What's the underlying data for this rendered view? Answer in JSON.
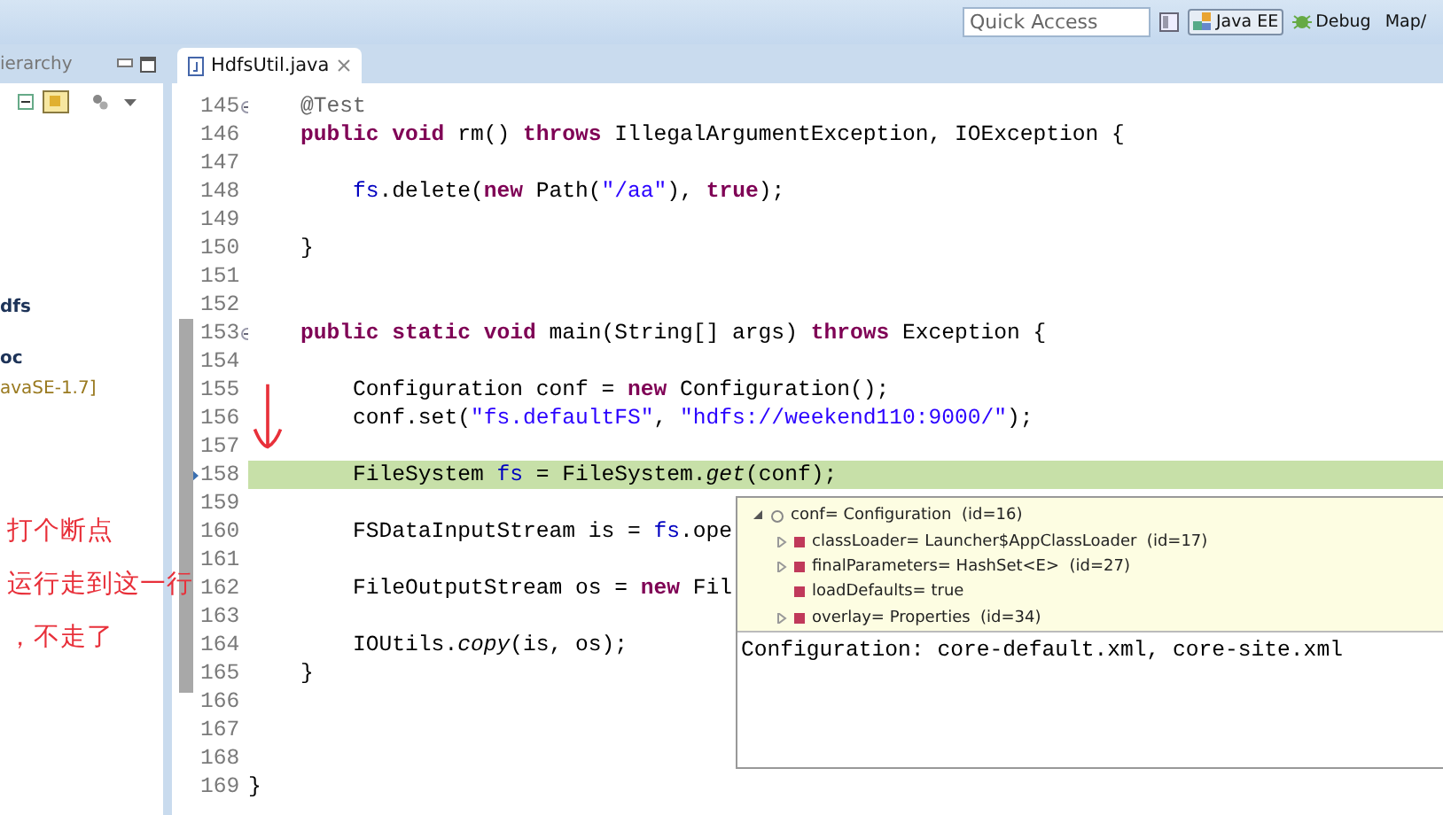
{
  "toolbar": {
    "quick_access": {
      "placeholder": "Quick Access"
    },
    "perspectives": [
      {
        "label": "Java EE",
        "selected": true
      },
      {
        "label": "Debug",
        "selected": false
      },
      {
        "label": "Map/",
        "selected": false
      }
    ]
  },
  "left_panel": {
    "tab_label": "ierarchy",
    "items": [
      {
        "label": "dfs",
        "kind": "project"
      },
      {
        "label": "oc",
        "kind": "project"
      },
      {
        "label": "avaSE-1.7]",
        "kind": "library"
      }
    ]
  },
  "editor": {
    "tab": {
      "label": "HdfsUtil.java",
      "selected": true
    },
    "lines": [
      {
        "number": "145",
        "foldable": true,
        "current": false,
        "tokens": [
          {
            "text": "    @Test",
            "kind": "annotation"
          }
        ]
      },
      {
        "number": "146",
        "foldable": false,
        "current": false,
        "tokens": [
          {
            "text": "    public void",
            "kind": "keyword"
          },
          {
            "text": " rm() ",
            "kind": "plain"
          },
          {
            "text": "throws",
            "kind": "keyword"
          },
          {
            "text": " IllegalArgumentException, IOException {",
            "kind": "plain"
          }
        ]
      },
      {
        "number": "147",
        "foldable": false,
        "current": false
      },
      {
        "number": "148",
        "foldable": false,
        "current": false,
        "tokens": [
          {
            "text": "        fs",
            "kind": "field"
          },
          {
            "text": ".delete(",
            "kind": "plain"
          },
          {
            "text": "new",
            "kind": "keyword"
          },
          {
            "text": " Path(",
            "kind": "plain"
          },
          {
            "text": "\"/aa\"",
            "kind": "string"
          },
          {
            "text": "), ",
            "kind": "plain"
          },
          {
            "text": "true",
            "kind": "keyword"
          },
          {
            "text": ");",
            "kind": "plain"
          }
        ]
      },
      {
        "number": "149",
        "foldable": false,
        "current": false
      },
      {
        "number": "150",
        "foldable": false,
        "current": false,
        "tokens": [
          {
            "text": "    }",
            "kind": "plain"
          }
        ]
      },
      {
        "number": "151",
        "foldable": false,
        "current": false
      },
      {
        "number": "152",
        "foldable": false,
        "current": false
      },
      {
        "number": "153",
        "foldable": true,
        "current": false,
        "tokens": [
          {
            "text": "    public static void",
            "kind": "keyword"
          },
          {
            "text": " main(String[] args) ",
            "kind": "plain"
          },
          {
            "text": "throws",
            "kind": "keyword"
          },
          {
            "text": " Exception {",
            "kind": "plain"
          }
        ]
      },
      {
        "number": "154",
        "foldable": false,
        "current": false
      },
      {
        "number": "155",
        "foldable": false,
        "current": false,
        "tokens": [
          {
            "text": "        Configuration conf = ",
            "kind": "plain"
          },
          {
            "text": "new",
            "kind": "keyword"
          },
          {
            "text": " Configuration();",
            "kind": "plain"
          }
        ]
      },
      {
        "number": "156",
        "foldable": false,
        "current": false,
        "tokens": [
          {
            "text": "        conf.set(",
            "kind": "plain"
          },
          {
            "text": "\"fs.defaultFS\"",
            "kind": "string"
          },
          {
            "text": ", ",
            "kind": "plain"
          },
          {
            "text": "\"hdfs://weekend110:9000/\"",
            "kind": "string"
          },
          {
            "text": ");",
            "kind": "plain"
          }
        ]
      },
      {
        "number": "157",
        "foldable": false,
        "current": false
      },
      {
        "number": "158",
        "foldable": false,
        "current": true,
        "tokens": [
          {
            "text": "        FileSystem ",
            "kind": "plain"
          },
          {
            "text": "fs",
            "kind": "field"
          },
          {
            "text": " = FileSystem.",
            "kind": "plain"
          },
          {
            "text": "get",
            "kind": "static"
          },
          {
            "text": "(conf);",
            "kind": "plain"
          }
        ]
      },
      {
        "number": "159",
        "foldable": false,
        "current": false
      },
      {
        "number": "160",
        "foldable": false,
        "current": false,
        "tokens": [
          {
            "text": "        FSDataInputStream is = ",
            "kind": "plain"
          },
          {
            "text": "fs",
            "kind": "field"
          },
          {
            "text": ".ope",
            "kind": "plain"
          }
        ]
      },
      {
        "number": "161",
        "foldable": false,
        "current": false
      },
      {
        "number": "162",
        "foldable": false,
        "current": false,
        "tokens": [
          {
            "text": "        FileOutputStream os = ",
            "kind": "plain"
          },
          {
            "text": "new",
            "kind": "keyword"
          },
          {
            "text": " Fil",
            "kind": "plain"
          }
        ]
      },
      {
        "number": "163",
        "foldable": false,
        "current": false
      },
      {
        "number": "164",
        "foldable": false,
        "current": false,
        "tokens": [
          {
            "text": "        IOUtils.",
            "kind": "plain"
          },
          {
            "text": "copy",
            "kind": "static"
          },
          {
            "text": "(is, os);",
            "kind": "plain"
          }
        ]
      },
      {
        "number": "165",
        "foldable": false,
        "current": false,
        "tokens": [
          {
            "text": "    }",
            "kind": "plain"
          }
        ]
      },
      {
        "number": "166",
        "foldable": false,
        "current": false
      },
      {
        "number": "167",
        "foldable": false,
        "current": false
      },
      {
        "number": "168",
        "foldable": false,
        "current": false
      },
      {
        "number": "169",
        "foldable": false,
        "current": false,
        "tokens": [
          {
            "text": "}",
            "kind": "plain"
          }
        ]
      }
    ]
  },
  "inspector": {
    "root": {
      "label": "conf= Configuration  (id=16)",
      "expanded": true,
      "children": [
        {
          "label": "classLoader= Launcher$AppClassLoader  (id=17)",
          "expandable": true
        },
        {
          "label": "finalParameters= HashSet<E>  (id=27)",
          "expandable": true
        },
        {
          "label": "loadDefaults= true",
          "expandable": false
        },
        {
          "label": "overlay= Properties  (id=34)",
          "expandable": true
        }
      ]
    },
    "detail": "Configuration: core-default.xml, core-site.xml"
  },
  "annotations": [
    "打个断点",
    "运行走到这一行",
    "，不走了"
  ]
}
